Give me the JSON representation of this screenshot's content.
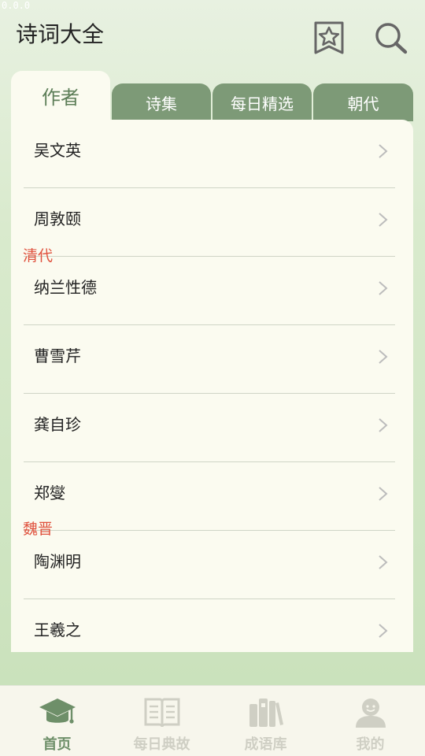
{
  "status_text": "0.0.0",
  "app_title": "诗词大全",
  "header": {
    "favorites_icon": "star-bookmark-icon",
    "search_icon": "search-icon"
  },
  "tabs": [
    {
      "label": "作者",
      "active": true
    },
    {
      "label": "诗集",
      "active": false
    },
    {
      "label": "每日精选",
      "active": false
    },
    {
      "label": "朝代",
      "active": false
    }
  ],
  "authors": [
    {
      "name": "吴文英"
    },
    {
      "name": "周敦颐"
    },
    {
      "name": "纳兰性德",
      "section": "清代"
    },
    {
      "name": "曹雪芹"
    },
    {
      "name": "龚自珍"
    },
    {
      "name": "郑燮"
    },
    {
      "name": "陶渊明",
      "section": "魏晋"
    },
    {
      "name": "王羲之"
    }
  ],
  "bottom_nav": [
    {
      "label": "首页",
      "icon": "graduation-cap-icon",
      "active": true
    },
    {
      "label": "每日典故",
      "icon": "open-book-icon",
      "active": false
    },
    {
      "label": "成语库",
      "icon": "books-icon",
      "active": false
    },
    {
      "label": "我的",
      "icon": "user-avatar-icon",
      "active": false
    }
  ],
  "colors": {
    "accent": "#6e8f69",
    "tab_inactive": "#7d9a77",
    "section_label": "#e0533f",
    "panel": "#fbfbf0"
  }
}
